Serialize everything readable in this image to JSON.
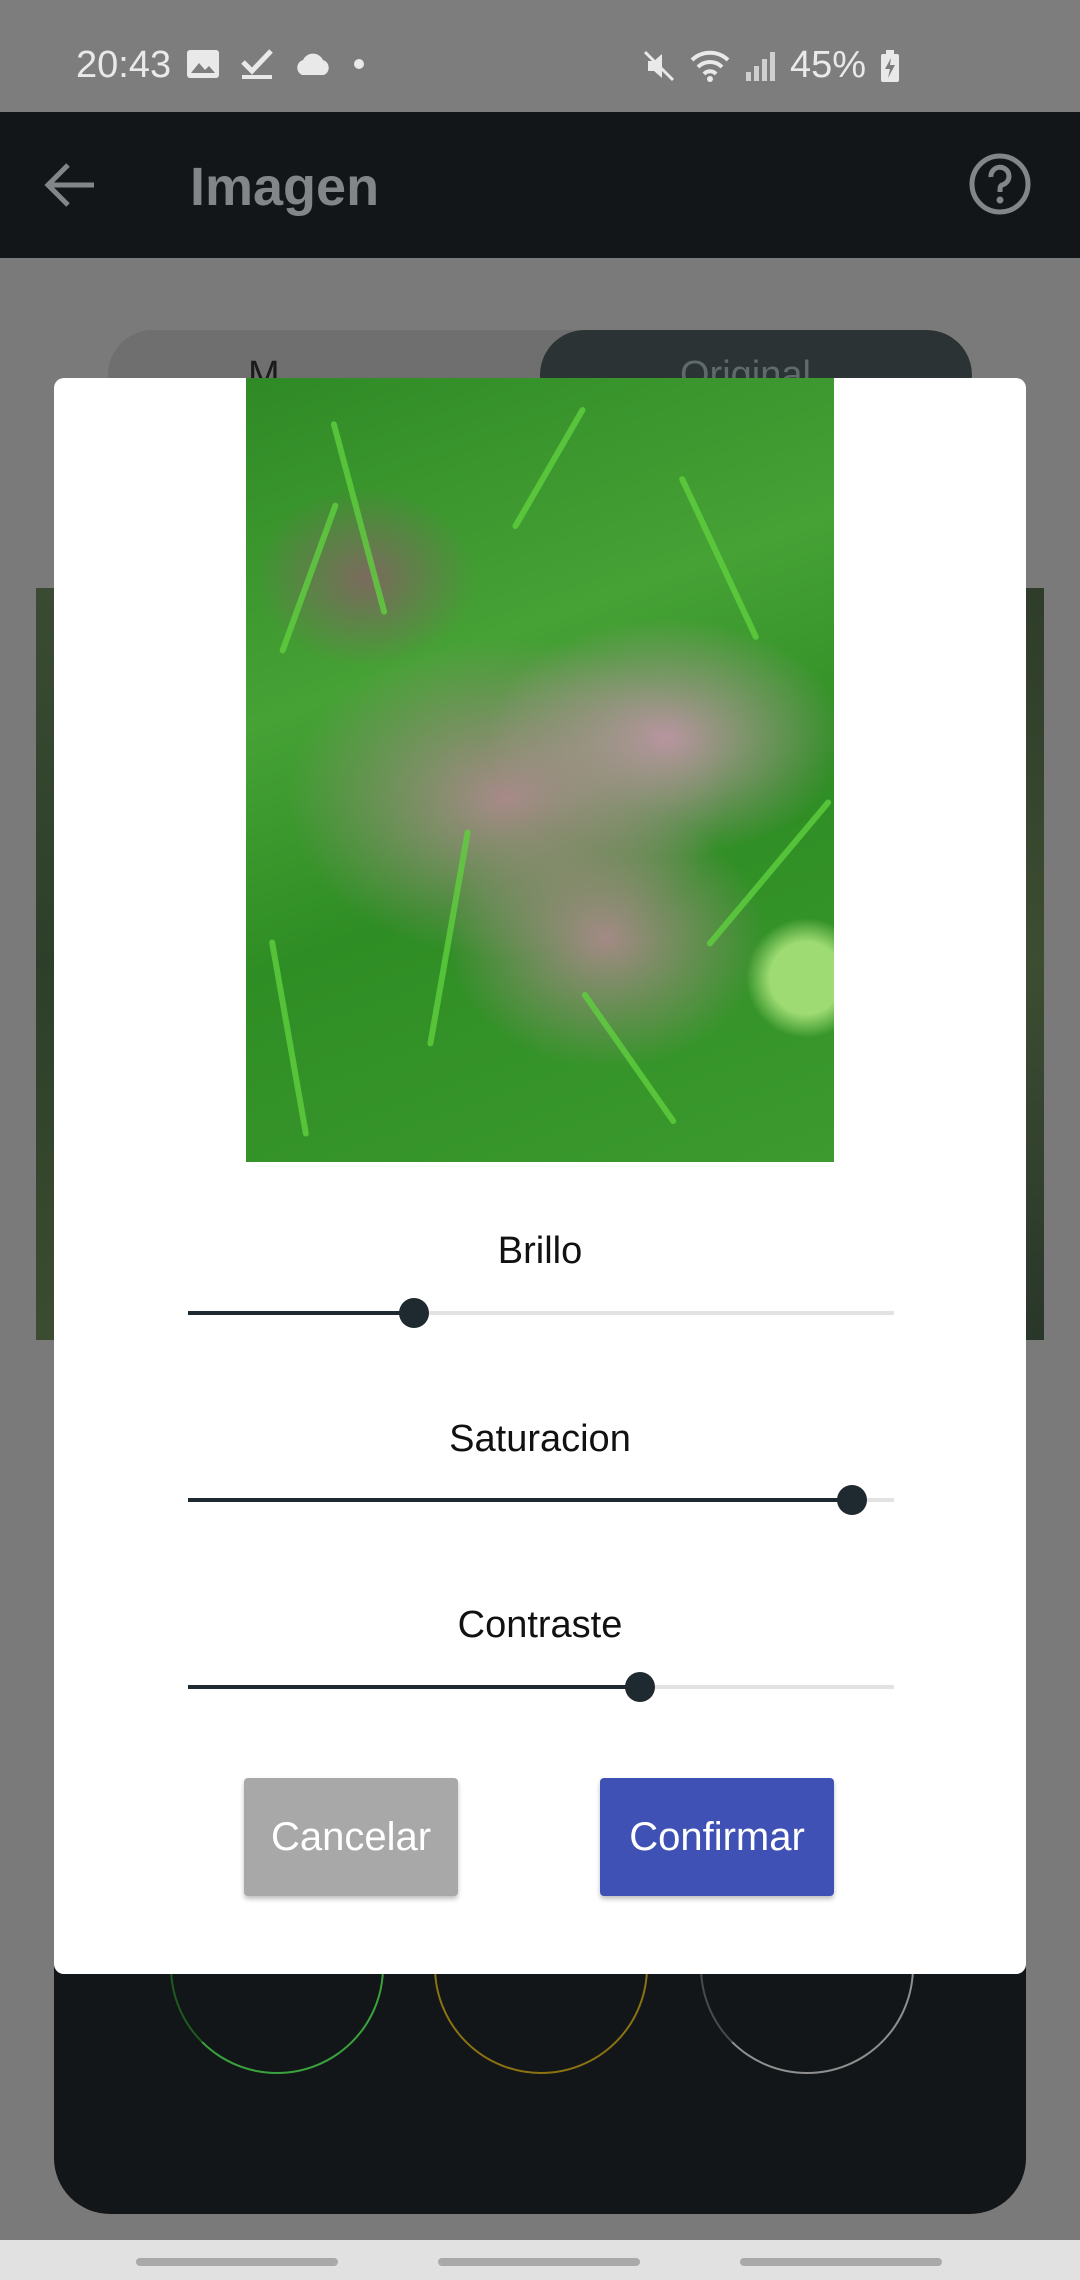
{
  "status_bar": {
    "time": "20:43",
    "battery": "45%",
    "left_icons": [
      "image-icon",
      "check-icon",
      "cloud-icon",
      "dot-icon"
    ],
    "right_icons": [
      "mute-icon",
      "wifi-icon",
      "signal-icon",
      "battery-icon"
    ]
  },
  "app_bar": {
    "title": "Imagen",
    "back_icon": "arrow-left-icon",
    "help_icon": "help-circle-icon"
  },
  "background": {
    "tab_left": "M",
    "tab_right": "Original"
  },
  "dialog": {
    "sliders": [
      {
        "label": "Brillo",
        "value": 0.32
      },
      {
        "label": "Saturacion",
        "value": 0.94
      },
      {
        "label": "Contraste",
        "value": 0.64
      }
    ],
    "cancel_label": "Cancelar",
    "confirm_label": "Confirmar"
  },
  "colors": {
    "confirm": "#3f51b5",
    "cancel": "#a8a8a8",
    "slider_active": "#1f2a30",
    "app_bar": "#121618"
  }
}
